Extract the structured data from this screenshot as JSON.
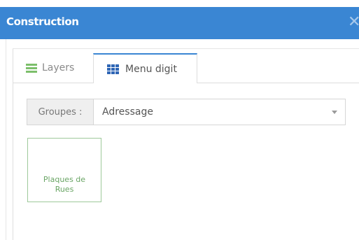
{
  "panel": {
    "title": "Construction",
    "close_glyph": "✕",
    "close_icon": "close-icon",
    "accent_color": "#3a86d3"
  },
  "tabs": [
    {
      "label": "Layers",
      "icon": "bars-icon",
      "icon_color": "#7cbf6b",
      "active": false
    },
    {
      "label": "Menu digit",
      "icon": "grid-icon",
      "icon_color": "#2f66b5",
      "active": true
    }
  ],
  "groupes": {
    "label": "Groupes :",
    "selected": "Adressage",
    "caret_icon": "chevron-down-icon"
  },
  "tiles": [
    {
      "label_line1": "Plaques de",
      "label_line2": "Rues",
      "color": "#6aa565"
    }
  ]
}
